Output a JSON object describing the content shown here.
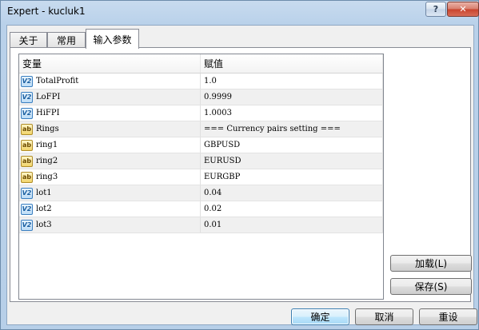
{
  "window": {
    "title": "Expert - kucluk1",
    "help_label": "?",
    "close_label": "✕"
  },
  "tabs": [
    {
      "label": "关于"
    },
    {
      "label": "常用"
    },
    {
      "label": "输入参数"
    }
  ],
  "table": {
    "headers": {
      "variable": "变量",
      "value": "赋值"
    },
    "rows": [
      {
        "name": "TotalProfit",
        "value": "1.0",
        "icon": "numeric-param-icon",
        "icon_text": "V2"
      },
      {
        "name": "LoFPI",
        "value": "0.9999",
        "icon": "numeric-param-icon",
        "icon_text": "V2"
      },
      {
        "name": "HiFPI",
        "value": "1.0003",
        "icon": "numeric-param-icon",
        "icon_text": "V2"
      },
      {
        "name": "Rings",
        "value": "=== Currency pairs setting ===",
        "icon": "string-param-icon",
        "icon_text": "ab"
      },
      {
        "name": "ring1",
        "value": "GBPUSD",
        "icon": "string-param-icon",
        "icon_text": "ab"
      },
      {
        "name": "ring2",
        "value": "EURUSD",
        "icon": "string-param-icon",
        "icon_text": "ab"
      },
      {
        "name": "ring3",
        "value": "EURGBP",
        "icon": "string-param-icon",
        "icon_text": "ab"
      },
      {
        "name": "lot1",
        "value": "0.04",
        "icon": "numeric-param-icon",
        "icon_text": "V2"
      },
      {
        "name": "lot2",
        "value": "0.02",
        "icon": "numeric-param-icon",
        "icon_text": "V2"
      },
      {
        "name": "lot3",
        "value": "0.01",
        "icon": "numeric-param-icon",
        "icon_text": "V2"
      }
    ]
  },
  "buttons": {
    "load": "加载(L)",
    "save": "保存(S)",
    "ok": "确定",
    "cancel": "取消",
    "reset": "重设"
  }
}
